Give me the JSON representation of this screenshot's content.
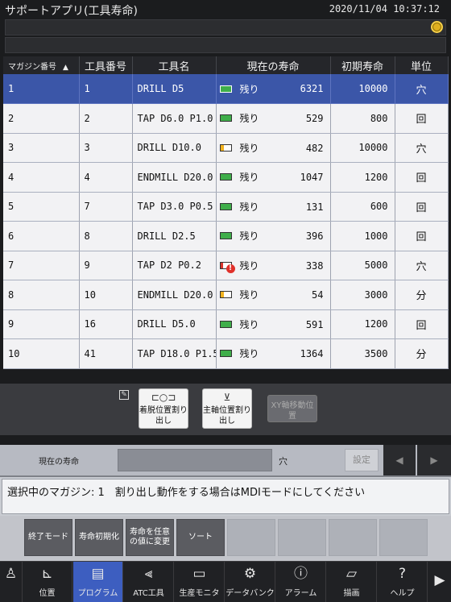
{
  "app": {
    "title": "サポートアプリ(工具寿命)",
    "datetime": "2020/11/04 10:37:12"
  },
  "table": {
    "headers": [
      "マガジン番号",
      "工具番号",
      "工具名",
      "現在の寿命",
      "初期寿命",
      "単位"
    ],
    "sort_indicator": "▲",
    "rows": [
      {
        "mag": "1",
        "tool": "1",
        "name": "DRILL D5",
        "status": "残り",
        "life": "6321",
        "init": "10000",
        "unit": "穴",
        "bar": 0.63,
        "warn": false,
        "selected": true
      },
      {
        "mag": "2",
        "tool": "2",
        "name": "TAP D6.0 P1.0",
        "status": "残り",
        "life": "529",
        "init": "800",
        "unit": "回",
        "bar": 0.66,
        "warn": false
      },
      {
        "mag": "3",
        "tool": "3",
        "name": "DRILL D10.0",
        "status": "残り",
        "life": "482",
        "init": "10000",
        "unit": "穴",
        "bar": 0.05,
        "warn": false
      },
      {
        "mag": "4",
        "tool": "4",
        "name": "ENDMILL D20.0",
        "status": "残り",
        "life": "1047",
        "init": "1200",
        "unit": "回",
        "bar": 0.87,
        "warn": false
      },
      {
        "mag": "5",
        "tool": "7",
        "name": "TAP D3.0 P0.5",
        "status": "残り",
        "life": "131",
        "init": "600",
        "unit": "回",
        "bar": 0.22,
        "warn": false
      },
      {
        "mag": "6",
        "tool": "8",
        "name": "DRILL D2.5",
        "status": "残り",
        "life": "396",
        "init": "1000",
        "unit": "回",
        "bar": 0.4,
        "warn": false
      },
      {
        "mag": "7",
        "tool": "9",
        "name": "TAP D2 P0.2",
        "status": "残り",
        "life": "338",
        "init": "5000",
        "unit": "穴",
        "bar": 0.07,
        "warn": true
      },
      {
        "mag": "8",
        "tool": "10",
        "name": "ENDMILL D20.0",
        "status": "残り",
        "life": "54",
        "init": "3000",
        "unit": "分",
        "bar": 0.02,
        "warn": false
      },
      {
        "mag": "9",
        "tool": "16",
        "name": "DRILL D5.0",
        "status": "残り",
        "life": "591",
        "init": "1200",
        "unit": "回",
        "bar": 0.49,
        "warn": false
      },
      {
        "mag": "10",
        "tool": "41",
        "name": "TAP D18.0 P1.5",
        "status": "残り",
        "life": "1364",
        "init": "3500",
        "unit": "分",
        "bar": 0.39,
        "warn": false
      }
    ]
  },
  "function_buttons": {
    "attach": "着脱位置割り出し",
    "spindle": "主軸位置割り出し",
    "xy": "XY軸移動位置"
  },
  "life_input": {
    "label": "現在の寿命",
    "unit": "穴",
    "set": "設定",
    "prev": "◀",
    "next": "▶"
  },
  "message": "選択中のマガジン: 1　割り出し動作をする場合はMDIモードにしてください",
  "softkeys": [
    "終了モード",
    "寿命初期化",
    "寿命を任意の値に変更",
    "ソート"
  ],
  "nav": [
    {
      "label": "",
      "icon": "person-icon"
    },
    {
      "label": "位置",
      "icon": "axis-icon"
    },
    {
      "label": "プログラム",
      "icon": "program-icon"
    },
    {
      "label": "ATC工具",
      "icon": "atc-tool-icon"
    },
    {
      "label": "生産モニタ",
      "icon": "monitor-icon"
    },
    {
      "label": "データバンク",
      "icon": "gear-icon"
    },
    {
      "label": "アラーム",
      "icon": "alarm-icon"
    },
    {
      "label": "描画",
      "icon": "cube-icon"
    },
    {
      "label": "ヘルプ",
      "icon": "help-icon"
    }
  ],
  "colors": {
    "selected_row": "#3b56a8",
    "bar_green": "#3fae4a",
    "bar_yellow": "#f2b21e",
    "bar_red": "#d8352c",
    "nav_active": "#3d5ec0"
  }
}
